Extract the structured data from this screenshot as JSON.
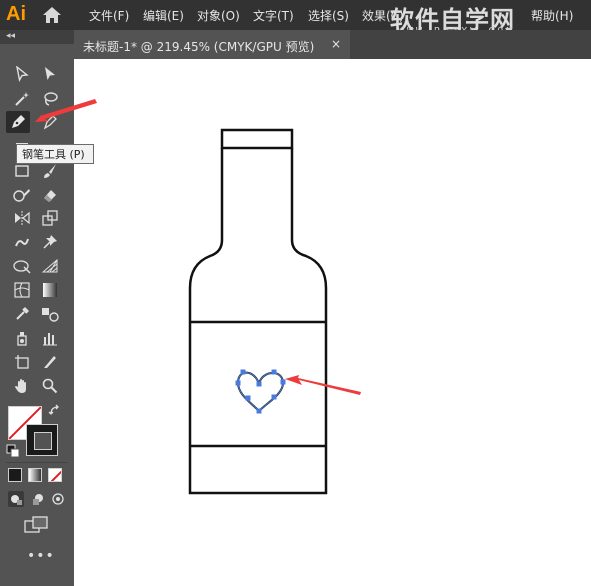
{
  "app": {
    "logo": "Ai"
  },
  "menu": {
    "items": [
      "文件(F)",
      "编辑(E)",
      "对象(O)",
      "文字(T)",
      "选择(S)",
      "效果(C)",
      "帮助(H)"
    ]
  },
  "watermark": {
    "title": "软件自学网",
    "url": "WWW.RJZXW.COM"
  },
  "document_tab": {
    "title": "未标题-1* @ 219.45% (CMYK/GPU 预览)",
    "close": "×"
  },
  "tooltip": {
    "text": "钢笔工具 (P)"
  },
  "toolbar": {
    "collapse": "◂◂",
    "more": "•••",
    "tools": [
      "selection-tool",
      "direct-selection-tool",
      "magic-wand-tool",
      "lasso-tool",
      "pen-tool",
      "curvature-tool",
      "type-tool",
      "line-tool",
      "rectangle-tool",
      "paintbrush-tool",
      "shaper-tool",
      "eraser-tool",
      "reflect-tool",
      "scale-tool",
      "warp-tool",
      "puppet-warp-tool",
      "free-transform-tool",
      "perspective-grid-tool",
      "mesh-tool",
      "gradient-tool",
      "eyedropper-tool",
      "blend-tool",
      "symbol-sprayer-tool",
      "column-graph-tool",
      "artboard-tool",
      "slice-tool",
      "hand-tool",
      "zoom-tool"
    ]
  },
  "colors": {
    "accent": "#ff9a00",
    "arrow": "#ee3b3b",
    "selection": "#4a7bdc"
  }
}
